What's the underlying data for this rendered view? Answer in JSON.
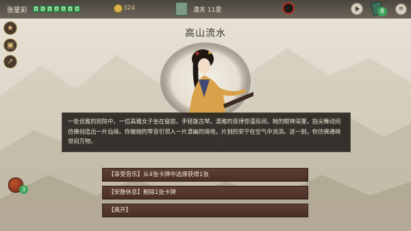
{
  "player": {
    "name": "张星彩",
    "hp_pips": 7
  },
  "gold": "324",
  "location": "潼关 11里",
  "deck_count": "8",
  "potion_count": "3",
  "event": {
    "title": "高山流水",
    "description": "一处优雅的别院中，一位高雅女子坐在窗前，手轻拨古琴。清雅的音律弥漫房间，她的眼神深邃，指尖舞动间仿佛创造出一片仙境。你被她的琴音引领入一片清幽的境地，片刻的安宁在空气中流淌。这一刻，你仿佛通晓世间万物。"
  },
  "options": [
    "【享受音乐】从4张卡牌中选择获得1张",
    "【安静休息】删除1张卡牌",
    "【离开】"
  ],
  "icons": {
    "coin": "coin-icon",
    "location": "scroll-icon",
    "time": "sun-icon",
    "play": "play-icon",
    "deck": "cards-icon",
    "menu": "menu-icon"
  },
  "colors": {
    "hp": "#3fae5a",
    "badge": "#3ca55a",
    "option_bg": "#4a2f27",
    "dialog_bg": "#201d19"
  }
}
